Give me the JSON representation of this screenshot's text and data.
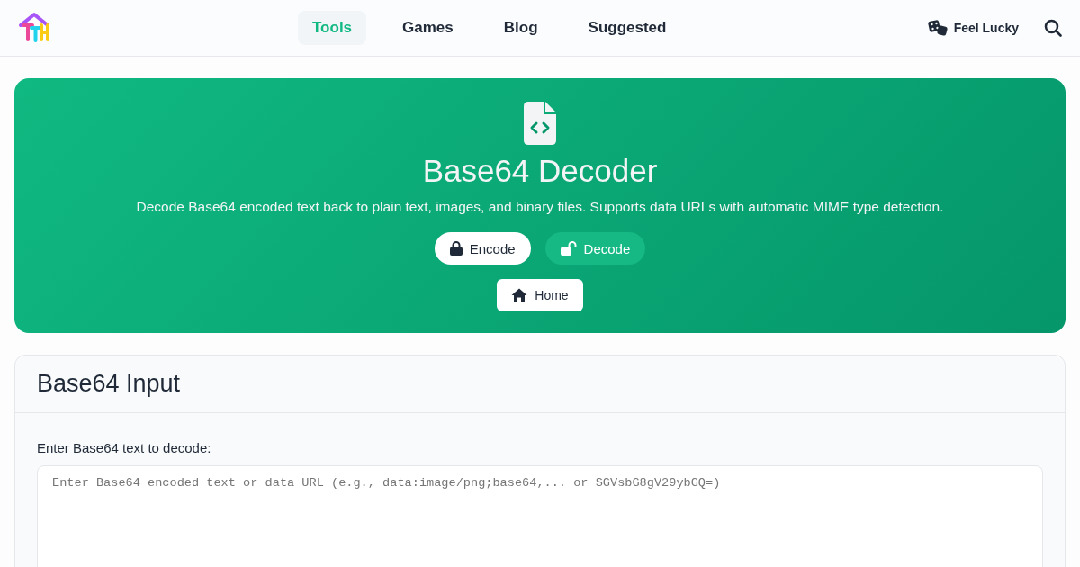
{
  "header": {
    "nav": [
      {
        "label": "Tools",
        "selected": true
      },
      {
        "label": "Games",
        "selected": false
      },
      {
        "label": "Blog",
        "selected": false
      },
      {
        "label": "Suggested",
        "selected": false
      }
    ],
    "lucky_button": "Feel Lucky"
  },
  "hero": {
    "title": "Base64 Decoder",
    "description": "Decode Base64 encoded text back to plain text, images, and binary files. Supports data URLs with automatic MIME type detection.",
    "mode_buttons": [
      {
        "label": "Encode",
        "kind": "encode",
        "selected": false
      },
      {
        "label": "Decode",
        "kind": "decode",
        "selected": true
      }
    ],
    "home_button": "Home"
  },
  "input_card": {
    "title": "Base64 Input",
    "field_label": "Enter Base64 text to decode:",
    "placeholder": "Enter Base64 encoded text or data URL (e.g., data:image/png;base64,... or SGVsbG8gV29ybGQ=)"
  }
}
